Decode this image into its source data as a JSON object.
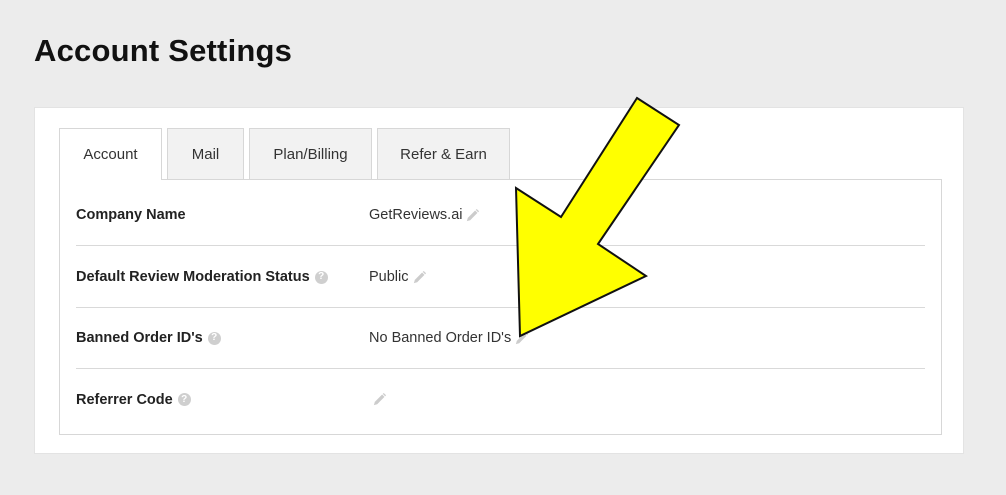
{
  "page": {
    "title": "Account Settings"
  },
  "tabs": [
    {
      "label": "Account",
      "active": true
    },
    {
      "label": "Mail",
      "active": false
    },
    {
      "label": "Plan/Billing",
      "active": false
    },
    {
      "label": "Refer & Earn",
      "active": false
    }
  ],
  "settings": [
    {
      "label": "Company Name",
      "value": "GetReviews.ai",
      "has_help": false
    },
    {
      "label": "Default Review Moderation Status",
      "value": "Public",
      "has_help": true
    },
    {
      "label": "Banned Order ID's",
      "value": "No Banned Order ID's",
      "has_help": true
    },
    {
      "label": "Referrer Code",
      "value": "",
      "has_help": true
    }
  ],
  "icons": {
    "help": "question-circle-icon",
    "edit": "pencil-icon"
  },
  "colors": {
    "background": "#ececec",
    "panel": "#ffffff",
    "arrow_fill": "#ffff00",
    "arrow_stroke": "#111111",
    "icon_gray": "#cfcfcf"
  }
}
